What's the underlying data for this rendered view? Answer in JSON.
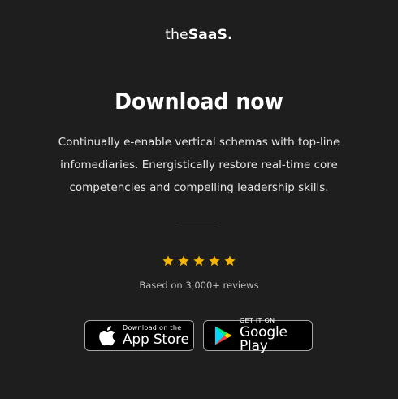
{
  "brand": {
    "logo_part1": "the",
    "logo_part2": "SaaS."
  },
  "hero": {
    "title": "Download now",
    "description": "Continually e-enable vertical schemas with top-line infomediaries. Energistically restore real-time core competencies and compelling leadership skills."
  },
  "rating": {
    "stars": 5,
    "star_color": "#f5b400",
    "text": "Based on 3,000+ reviews"
  },
  "stores": {
    "apple": {
      "small": "Download on the",
      "big": "App Store",
      "icon": "apple-icon"
    },
    "google": {
      "small": "GET IT ON",
      "big": "Google Play",
      "icon": "google-play-icon"
    }
  },
  "colors": {
    "background": "#1e1e1e",
    "text": "#ffffff",
    "accent_star": "#f5b400"
  }
}
